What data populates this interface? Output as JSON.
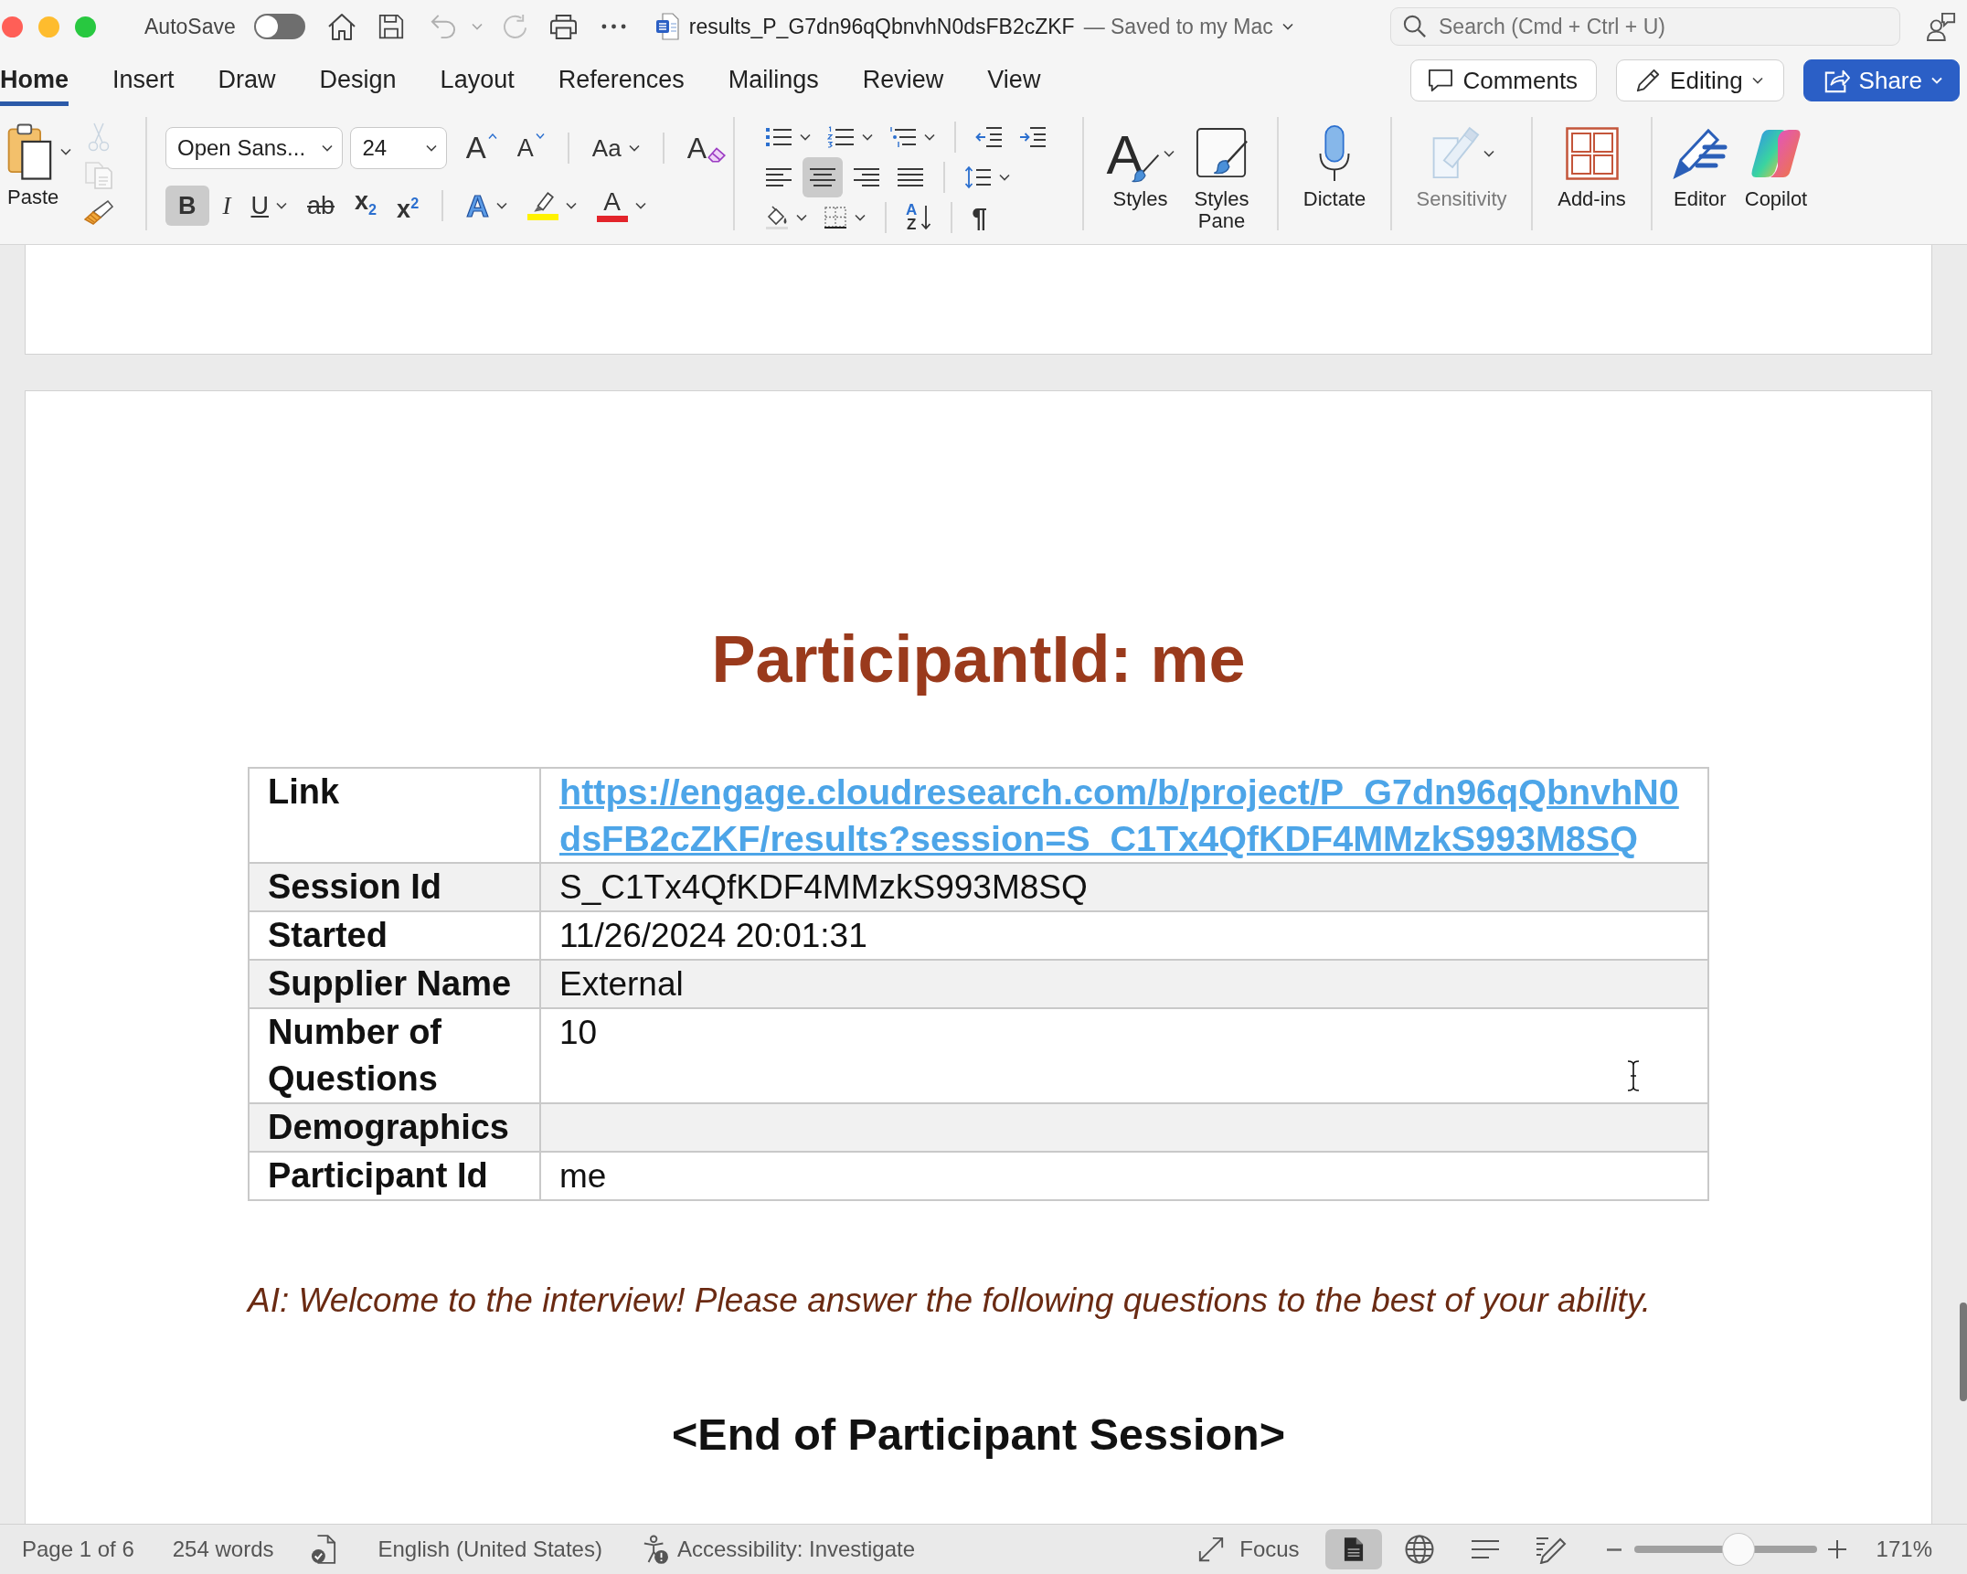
{
  "title_bar": {
    "autosave": {
      "label": "AutoSave",
      "on": false
    },
    "document_name": "results_P_G7dn96qQbnvhN0dsFB2cZKF",
    "save_status": "— Saved to my Mac",
    "search": {
      "placeholder": "Search (Cmd + Ctrl + U)"
    }
  },
  "tabs": [
    {
      "label": "Home",
      "selected": true
    },
    {
      "label": "Insert",
      "selected": false
    },
    {
      "label": "Draw",
      "selected": false
    },
    {
      "label": "Design",
      "selected": false
    },
    {
      "label": "Layout",
      "selected": false
    },
    {
      "label": "References",
      "selected": false
    },
    {
      "label": "Mailings",
      "selected": false
    },
    {
      "label": "Review",
      "selected": false
    },
    {
      "label": "View",
      "selected": false
    }
  ],
  "actions": [
    {
      "kind": "comments",
      "label": "Comments"
    },
    {
      "kind": "editing",
      "label": "Editing"
    },
    {
      "kind": "share",
      "label": "Share"
    }
  ],
  "ribbon": {
    "paste": {
      "label": "Paste"
    },
    "clipboard_tools": [
      {
        "kind": "cut",
        "disabled": true
      },
      {
        "kind": "copy",
        "disabled": true
      },
      {
        "kind": "format_painter",
        "disabled": false
      }
    ],
    "font": {
      "name": "Open Sans...",
      "size": "24",
      "rows": [
        {
          "groups": [
            {
              "items": [
                {
                  "kind": "grow",
                  "glyph": "A"
                },
                {
                  "kind": "shrink",
                  "glyph": "A"
                }
              ]
            },
            {
              "items": [
                {
                  "kind": "case",
                  "glyph": "Aa"
                }
              ]
            },
            {
              "items": [
                {
                  "kind": "clear",
                  "glyph": "A"
                }
              ]
            }
          ]
        },
        {
          "groups": [
            {
              "items": [
                {
                  "kind": "bold",
                  "glyph": "B",
                  "on": true
                },
                {
                  "kind": "italic",
                  "glyph": "I",
                  "on": false
                },
                {
                  "kind": "underline",
                  "glyph": "U",
                  "on": false
                },
                {
                  "kind": "strike",
                  "glyph": "ab",
                  "on": false
                },
                {
                  "kind": "subscript",
                  "glyph": "x$_{2}$",
                  "on": false
                },
                {
                  "kind": "superscript",
                  "glyph": "x$^{2}$",
                  "on": false
                }
              ]
            },
            {
              "items": [
                {
                  "kind": "effects",
                  "glyph": "A"
                },
                {
                  "kind": "highlight",
                  "color": "#fff200"
                },
                {
                  "kind": "font_color",
                  "glyph": "A",
                  "color": "#e3242b"
                }
              ]
            }
          ]
        }
      ]
    },
    "paragraph": {
      "rows": [
        {
          "groups": [
            {
              "items": [
                {
                  "kind": "bullets"
                },
                {
                  "kind": "numbering"
                },
                {
                  "kind": "multilevel"
                }
              ]
            },
            {
              "items": [
                {
                  "kind": "decrease_indent"
                },
                {
                  "kind": "increase_indent"
                }
              ]
            }
          ]
        },
        {
          "groups": [
            {
              "items": [
                {
                  "kind": "align_left",
                  "on": false
                },
                {
                  "kind": "align_center",
                  "on": true
                },
                {
                  "kind": "align_right",
                  "on": false
                },
                {
                  "kind": "justify",
                  "on": false
                }
              ]
            },
            {
              "items": [
                {
                  "kind": "line_spacing"
                }
              ]
            }
          ]
        },
        {
          "groups": [
            {
              "items": [
                {
                  "kind": "shading"
                },
                {
                  "kind": "borders"
                }
              ]
            },
            {
              "items": [
                {
                  "kind": "sort",
                  "glyphs": [
                    "A",
                    "Z"
                  ]
                }
              ]
            },
            {
              "items": [
                {
                  "kind": "pilcrow",
                  "glyph": "¶"
                }
              ]
            }
          ]
        }
      ]
    },
    "large_groups": [
      {
        "buttons": [
          {
            "kind": "styles",
            "label": "Styles",
            "glyph": "A",
            "disabled": false
          },
          {
            "kind": "styles_pane",
            "label": "Styles Pane",
            "disabled": false
          }
        ]
      },
      {
        "buttons": [
          {
            "kind": "dictate",
            "label": "Dictate",
            "disabled": false
          }
        ]
      },
      {
        "buttons": [
          {
            "kind": "sensitivity",
            "label": "Sensitivity",
            "disabled": true
          }
        ]
      },
      {
        "buttons": [
          {
            "kind": "add_ins",
            "label": "Add-ins",
            "disabled": false
          }
        ]
      },
      {
        "buttons": [
          {
            "kind": "editor",
            "label": "Editor",
            "disabled": false
          },
          {
            "kind": "copilot",
            "label": "Copilot",
            "disabled": false
          }
        ]
      }
    ]
  },
  "document": {
    "heading": "ParticipantId: me",
    "details": [
      {
        "label": "Link",
        "kind": "link",
        "value": "https://engage.cloudresearch.com/b/project/P_G7dn96qQbnvhN0dsFB2cZKF/results?session=S_C1Tx4QfKDF4MMzkS993M8SQ"
      },
      {
        "label": "Session Id",
        "kind": "text",
        "value": "S_C1Tx4QfKDF4MMzkS993M8SQ"
      },
      {
        "label": "Started",
        "kind": "text",
        "value": "11/26/2024 20:01:31"
      },
      {
        "label": "Supplier Name",
        "kind": "text",
        "value": "External"
      },
      {
        "label": "Number of Questions",
        "kind": "text",
        "value": "10"
      },
      {
        "label": "Demographics",
        "kind": "text"
      },
      {
        "label": "Participant Id",
        "kind": "text",
        "value": "me"
      }
    ],
    "ai_message": "AI: Welcome to the interview! Please answer the following questions to the best of your ability.",
    "closing": "<End of Participant Session>"
  },
  "status_bar": {
    "page": "Page 1 of 6",
    "words": "254 words",
    "language": "English (United States)",
    "accessibility": "Accessibility: Investigate",
    "focus": "Focus",
    "views": [
      {
        "kind": "print",
        "selected": true
      },
      {
        "kind": "web",
        "selected": false
      },
      {
        "kind": "outline",
        "selected": false
      },
      {
        "kind": "draft",
        "selected": false
      }
    ],
    "zoom": {
      "level": 0.57,
      "reading": "171%"
    }
  }
}
